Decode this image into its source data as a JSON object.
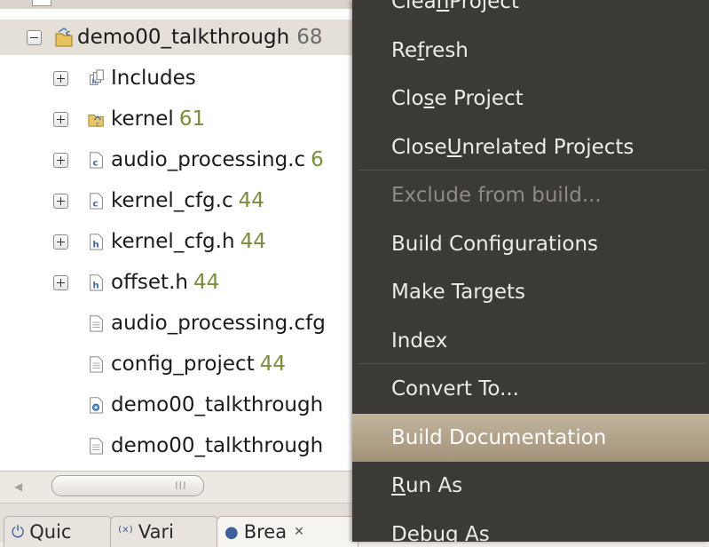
{
  "tree": {
    "root": {
      "name": "demo00_talkthrough",
      "count": "68"
    },
    "items": [
      {
        "name": "Includes",
        "count": "",
        "expander": "plus",
        "icon": "includes-icon"
      },
      {
        "name": "kernel",
        "count": "61",
        "expander": "plus",
        "icon": "folder-icon"
      },
      {
        "name": "audio_processing.c",
        "count": "6",
        "expander": "plus",
        "icon": "c-source-file-icon"
      },
      {
        "name": "kernel_cfg.c",
        "count": "44",
        "expander": "plus",
        "icon": "c-source-file-icon"
      },
      {
        "name": "kernel_cfg.h",
        "count": "44",
        "expander": "plus",
        "icon": "header-file-icon"
      },
      {
        "name": "offset.h",
        "count": "44",
        "expander": "plus",
        "icon": "header-file-icon"
      },
      {
        "name": "audio_processing.cfg",
        "count": "",
        "expander": "none",
        "icon": "file-icon"
      },
      {
        "name": "config_project",
        "count": "44",
        "expander": "none",
        "icon": "file-icon"
      },
      {
        "name": "demo00_talkthrough",
        "count": "",
        "expander": "none",
        "icon": "config-file-icon"
      },
      {
        "name": "demo00_talkthrough",
        "count": "",
        "expander": "none",
        "icon": "file-icon"
      }
    ]
  },
  "scrollbar": {
    "grip": "III"
  },
  "tabs": [
    {
      "label": "Quic",
      "icon": "quick-access-icon"
    },
    {
      "label": "Vari",
      "icon": "variables-icon"
    },
    {
      "label": "Brea",
      "icon": "breakpoints-icon",
      "close": "✕"
    }
  ],
  "menu": {
    "items": [
      {
        "label": "Clean Project",
        "mnemonic": "n"
      },
      {
        "label": "Refresh",
        "mnemonic": "f"
      },
      {
        "label": "Close Project",
        "mnemonic": "s"
      },
      {
        "label": "Close Unrelated Projects",
        "mnemonic": "U"
      },
      {
        "label": "Exclude from build...",
        "disabled": true
      },
      {
        "label": "Build Configurations"
      },
      {
        "label": "Make Targets"
      },
      {
        "label": "Index"
      },
      {
        "label": "Convert To..."
      },
      {
        "label": "Build Documentation",
        "highlighted": true
      },
      {
        "label": "Run As",
        "mnemonic": "R"
      },
      {
        "label": "Debug As",
        "mnemonic": "D"
      }
    ]
  },
  "colors": {
    "menu_bg": "#3c3a36",
    "menu_highlight": "#b3a48c",
    "count_text": "#7a8d3c",
    "root_row_bg": "#e4dfd7"
  }
}
